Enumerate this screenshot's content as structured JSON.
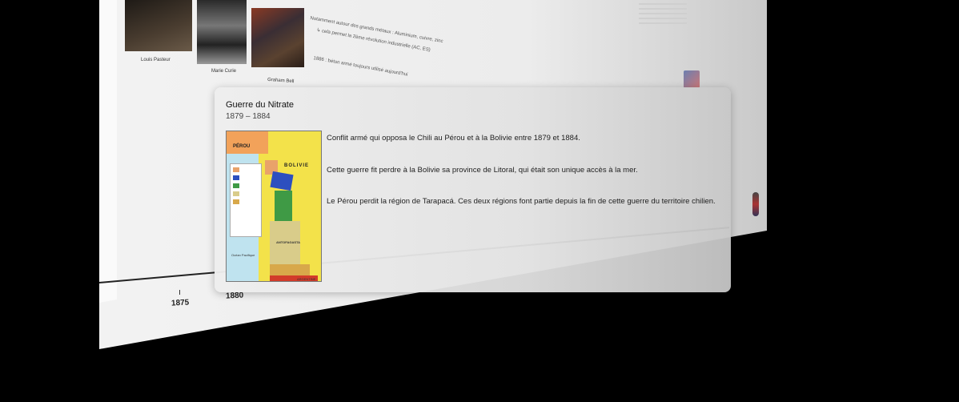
{
  "background_page": {
    "portraits": [
      {
        "caption": "Louis Pasteur"
      },
      {
        "caption": "Marie Curie"
      },
      {
        "caption": "Graham Bell"
      }
    ],
    "notes": [
      "Notamment autour des grands métaux : Aluminium, cuivre, zinc",
      "↳ cela permet la 2ème révolution industrielle (AC, ES)",
      "1886 : béton armé toujours utilisé aujourd'hui"
    ],
    "timeline_ticks": [
      "1875",
      "1880"
    ]
  },
  "card": {
    "title": "Guerre du Nitrate",
    "dates": "1879 – 1884",
    "paragraphs": [
      "Conflit armé qui opposa le Chili au Pérou et à la Bolivie entre 1879 et 1884.",
      "Cette guerre fit perdre à la Bolivie sa province de Litoral, qui était son unique accès à la mer.",
      "Le Pérou perdit la région de Tarapacá. Ces deux régions font partie depuis la fin de cette guerre du territoire chilien."
    ],
    "map": {
      "labels": {
        "peru": "PÉROU",
        "bolivia": "BOLIVIE",
        "antofagasta": "ANTOFAGASTA",
        "ocean": "Océan Pacifique",
        "argentina": "ARGENTINE"
      }
    }
  }
}
